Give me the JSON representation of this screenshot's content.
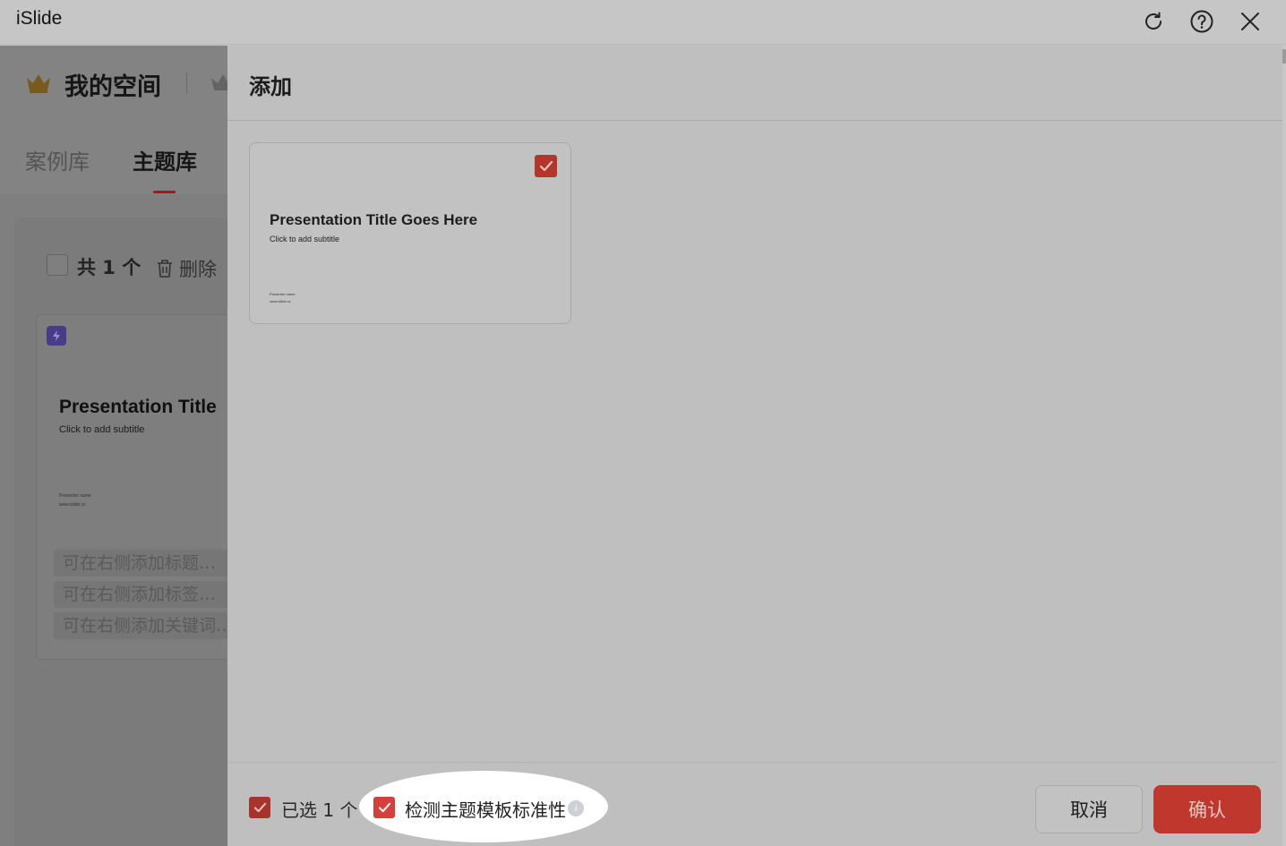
{
  "window": {
    "app_title": "iSlide"
  },
  "left_panel": {
    "space_title": "我的空间",
    "tabs": [
      {
        "label": "案例库",
        "active": false
      },
      {
        "label": "主题库",
        "active": true
      }
    ],
    "select_all_total": "共 1 个",
    "delete_label": "删除",
    "template_card": {
      "title": "Presentation Title",
      "subtitle": "Click to add subtitle",
      "presenter": "Presenter name",
      "site": "www.islide.cc"
    },
    "fields": [
      {
        "placeholder": "可在右侧添加标题…"
      },
      {
        "placeholder": "可在右侧添加标签…"
      },
      {
        "placeholder": "可在右侧添加关键词…"
      }
    ]
  },
  "dialog": {
    "title": "添加",
    "thumbnail": {
      "title": "Presentation Title Goes Here",
      "subtitle": "Click to add subtitle",
      "presenter": "Presenter name",
      "site": "www.islide.cc",
      "checked": true
    },
    "footer": {
      "selected_label": "已选 1 个",
      "detect_label": "检测主题模板标准性",
      "cancel_label": "取消",
      "confirm_label": "确认"
    }
  },
  "colors": {
    "accent": "#c0382d",
    "checkbox": "#d7403a",
    "highlight": "#ffffff"
  },
  "icons": [
    "refresh-icon",
    "help-icon",
    "close-icon",
    "crown-icon",
    "trash-icon",
    "bolt-icon",
    "check-icon",
    "info-icon"
  ]
}
